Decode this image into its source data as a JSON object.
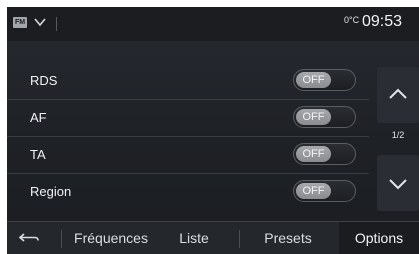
{
  "statusbar": {
    "source_icon": "radio-source-icon",
    "source_text": "FM",
    "temperature": "0°C",
    "time": "09:53"
  },
  "settings": [
    {
      "label": "RDS",
      "value": "OFF"
    },
    {
      "label": "AF",
      "value": "OFF"
    },
    {
      "label": "TA",
      "value": "OFF"
    },
    {
      "label": "Region",
      "value": "OFF"
    }
  ],
  "pager": {
    "page": "1/2"
  },
  "tabs": {
    "back_icon": "back-arrow-icon",
    "frequences": "Fréquences",
    "liste": "Liste",
    "presets": "Presets",
    "options": "Options"
  }
}
